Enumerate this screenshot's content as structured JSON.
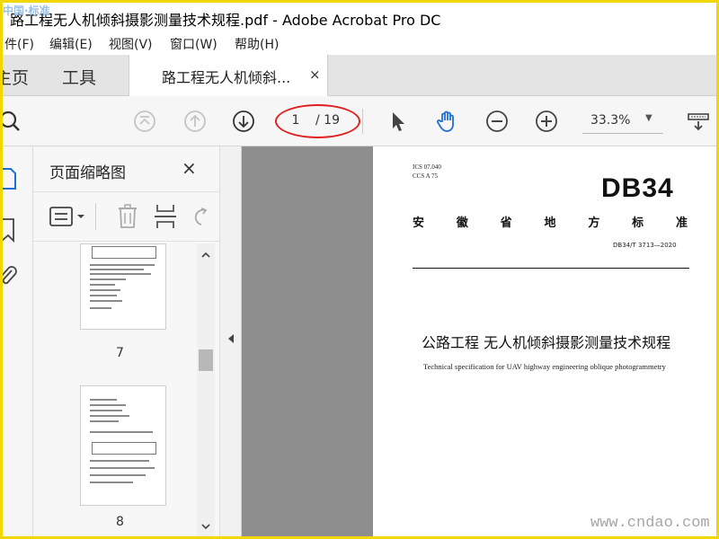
{
  "window": {
    "title": "路工程无人机倾斜摄影测量技术规程.pdf - Adobe Acrobat Pro DC",
    "watermark_top": "中国·标准"
  },
  "menu": [
    "件(F)",
    "编辑(E)",
    "视图(V)",
    "窗口(W)",
    "帮助(H)"
  ],
  "tabs": {
    "home": "主页",
    "tools": "工具",
    "doc_label": "路工程无人机倾斜...",
    "close_glyph": "×"
  },
  "toolbar": {
    "current_page": "1",
    "total_pages": "/ 19",
    "zoom": "33.3%",
    "zoom_caret": "▼"
  },
  "panel": {
    "title": "页面缩略图",
    "close_glyph": "×",
    "thumbnails": [
      {
        "label": "7"
      },
      {
        "label": "8"
      }
    ]
  },
  "document": {
    "ics": "ICS  07.040",
    "ccs": "CCS  A 75",
    "db_logo": "DB34",
    "standard_chars": [
      "安",
      "徽",
      "省",
      "地",
      "方",
      "标",
      "准"
    ],
    "code": "DB34/T  3713—2020",
    "title": "公路工程  无人机倾斜摄影测量技术规程",
    "subtitle": "Technical specification for UAV highway engineering oblique photogrammetry"
  },
  "watermark_bottom": "www.cndao.com",
  "colors": {
    "accent_red": "#e02020",
    "frame_yellow": "#f2d600"
  }
}
